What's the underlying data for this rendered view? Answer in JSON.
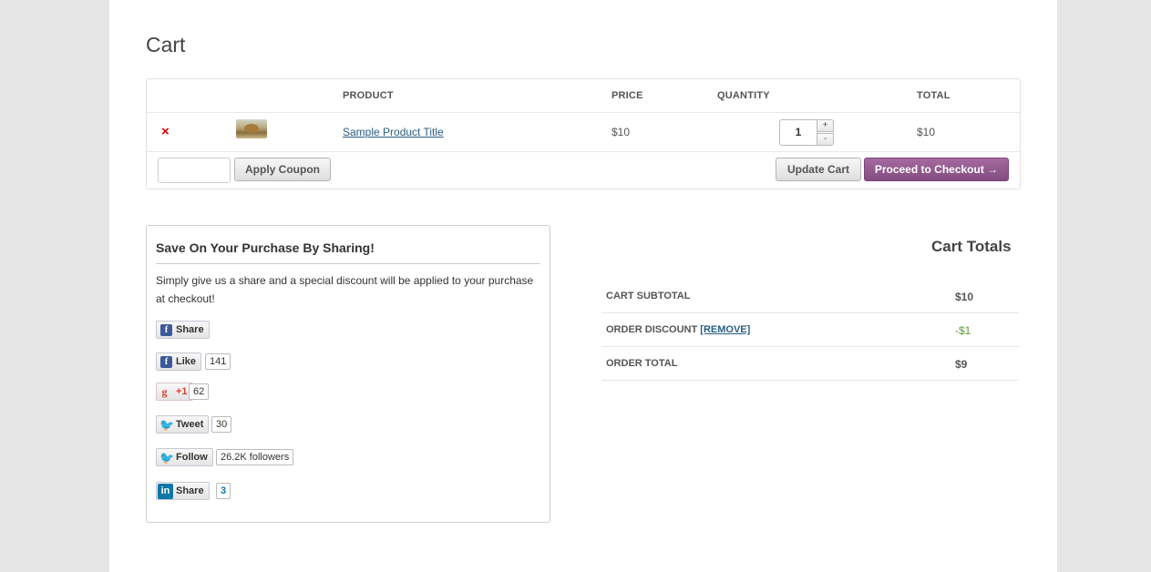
{
  "page": {
    "title": "Cart"
  },
  "cart": {
    "headers": {
      "product": "PRODUCT",
      "price": "PRICE",
      "quantity": "QUANTITY",
      "total": "TOTAL"
    },
    "items": [
      {
        "remove_icon": "×",
        "title": "Sample Product Title",
        "price": "$10",
        "quantity": "1",
        "total": "$10"
      }
    ],
    "qty_plus": "+",
    "qty_minus": "-",
    "coupon_placeholder": "",
    "apply_coupon_label": "Apply Coupon",
    "update_cart_label": "Update Cart",
    "checkout_label": "Proceed to Checkout →"
  },
  "share": {
    "title": "Save On Your Purchase By Sharing!",
    "description": "Simply give us a share and a special discount will be applied to your purchase at checkout!",
    "fb_share": {
      "icon": "f",
      "label": "Share"
    },
    "fb_like": {
      "icon": "f",
      "label": "Like",
      "count": "141"
    },
    "gplus": {
      "icon": "g",
      "label": "+1",
      "count": "62"
    },
    "tweet": {
      "icon": "🐦",
      "label": "Tweet",
      "count": "30"
    },
    "follow": {
      "icon": "🐦",
      "label": "Follow",
      "count": "26.2K followers"
    },
    "linkedin": {
      "icon": "in",
      "label": "Share",
      "count": "3"
    }
  },
  "totals": {
    "title": "Cart Totals",
    "subtotal_label": "CART SUBTOTAL",
    "subtotal_value": "$10",
    "discount_label": "ORDER DISCOUNT",
    "discount_remove": "[REMOVE]",
    "discount_value": "-$1",
    "order_total_label": "ORDER TOTAL",
    "order_total_value": "$9"
  },
  "colors": {
    "checkout": "#834c80",
    "link": "#2a5d84",
    "remove": "#dd0000",
    "discount": "#5b9b3a"
  }
}
